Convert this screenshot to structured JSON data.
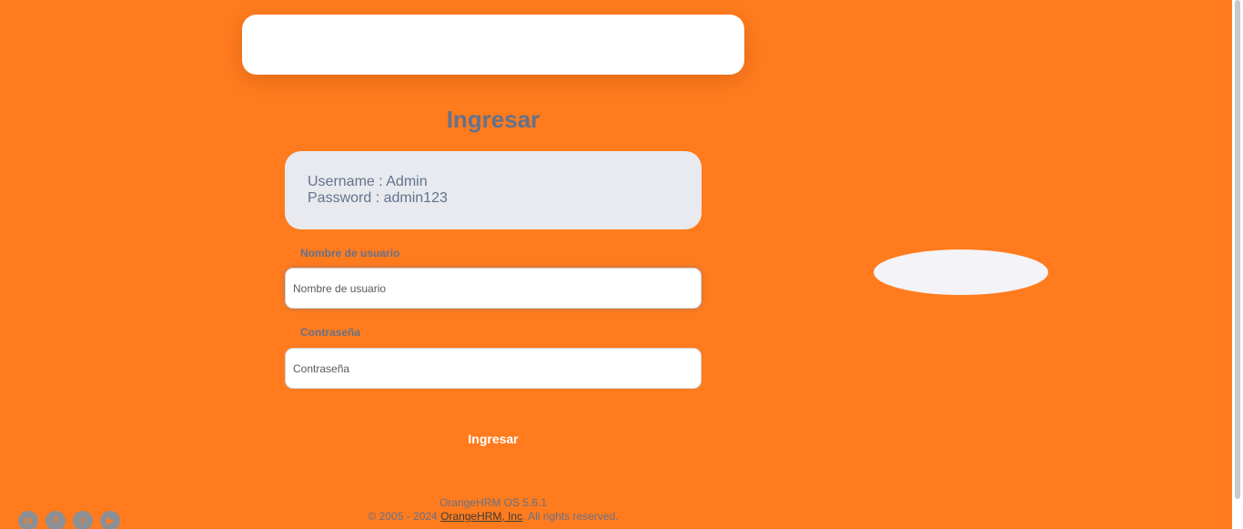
{
  "login": {
    "title": "Ingresar",
    "credentials": {
      "username_line": "Username : Admin",
      "password_line": "Password : admin123"
    },
    "username": {
      "label": "Nombre de usuario",
      "placeholder": "Nombre de usuario",
      "value": ""
    },
    "password": {
      "label": "Contraseña",
      "placeholder": "Contraseña",
      "value": ""
    },
    "submit_label": "Ingresar"
  },
  "socials": [
    {
      "icon": "linkedin-icon",
      "glyph": "in"
    },
    {
      "icon": "facebook-icon",
      "glyph": "f"
    },
    {
      "icon": "twitter-icon",
      "glyph": "t"
    },
    {
      "icon": "youtube-icon",
      "glyph": "▶"
    }
  ],
  "footer": {
    "version": "OrangeHRM OS 5.6.1",
    "copyright_prefix": "© 2005 - 2024 ",
    "company_link": "OrangeHRM, Inc",
    "copyright_suffix": ". All rights reserved."
  },
  "colors": {
    "background": "#ff7b1d",
    "text_primary": "#64728c",
    "card_gray": "#e8eaef",
    "white": "#ffffff"
  }
}
